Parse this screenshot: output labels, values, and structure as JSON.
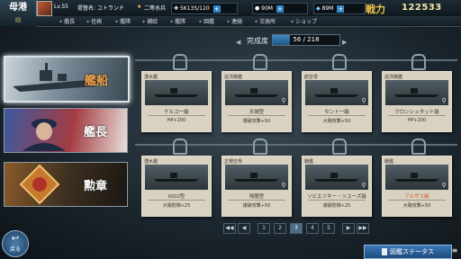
{
  "header": {
    "location": "母港",
    "level": "Lv.55",
    "player_name": "提督名: ユトランド",
    "rank": "二等水兵",
    "resources": [
      {
        "name": "crew",
        "value": "5K135/120"
      },
      {
        "name": "fuel",
        "value": "90M"
      },
      {
        "name": "gem",
        "value": "89M"
      }
    ],
    "power_label": "戦力",
    "power_value": "122533"
  },
  "menu": [
    "艦長",
    "任務",
    "艦隊",
    "補給",
    "艦隊",
    "図鑑",
    "連絡",
    "交換所",
    "ショップ"
  ],
  "tabs": [
    {
      "label": "艦船",
      "active": true
    },
    {
      "label": "艦長",
      "active": false
    },
    {
      "label": "勲章",
      "active": false
    }
  ],
  "back_label": "戻る",
  "progress": {
    "label": "完成度",
    "value": "56 / 218",
    "fraction": 0.257
  },
  "cards": [
    {
      "type": "潜水艦",
      "name": "ケルコー級",
      "effect": "HP+200"
    },
    {
      "type": "巡洋戦艦",
      "name": "天城型",
      "effect": "爆破攻撃+50"
    },
    {
      "type": "航空母",
      "name": "セント一級",
      "effect": "大砲攻撃+50"
    },
    {
      "type": "巡洋戦艦",
      "name": "クロンシュタット級",
      "effect": "HP+200"
    },
    {
      "type": "潜水艦",
      "name": "IXD2型",
      "effect": "大砲防御+25"
    },
    {
      "type": "正規空母",
      "name": "飛龍型",
      "effect": "爆破攻撃+50"
    },
    {
      "type": "戦艦",
      "name": "ソビエツキー・ソユーズ級",
      "effect": "爆破防御+25"
    },
    {
      "type": "戦艦",
      "name": "アルザス級",
      "effect": "大砲攻撃+50",
      "highlight": true
    }
  ],
  "pagination": {
    "pages": [
      "1",
      "2",
      "3",
      "4",
      "5"
    ],
    "current": "3",
    "first": "◀◀",
    "prev": "◀",
    "next": "▶",
    "last": "▶▶"
  },
  "illustrated_button": "図鑑ステータス",
  "colors": {
    "accent_orange": "#f1a24a",
    "power_gold": "#f3c648",
    "button_blue": "#2f6ca6"
  }
}
